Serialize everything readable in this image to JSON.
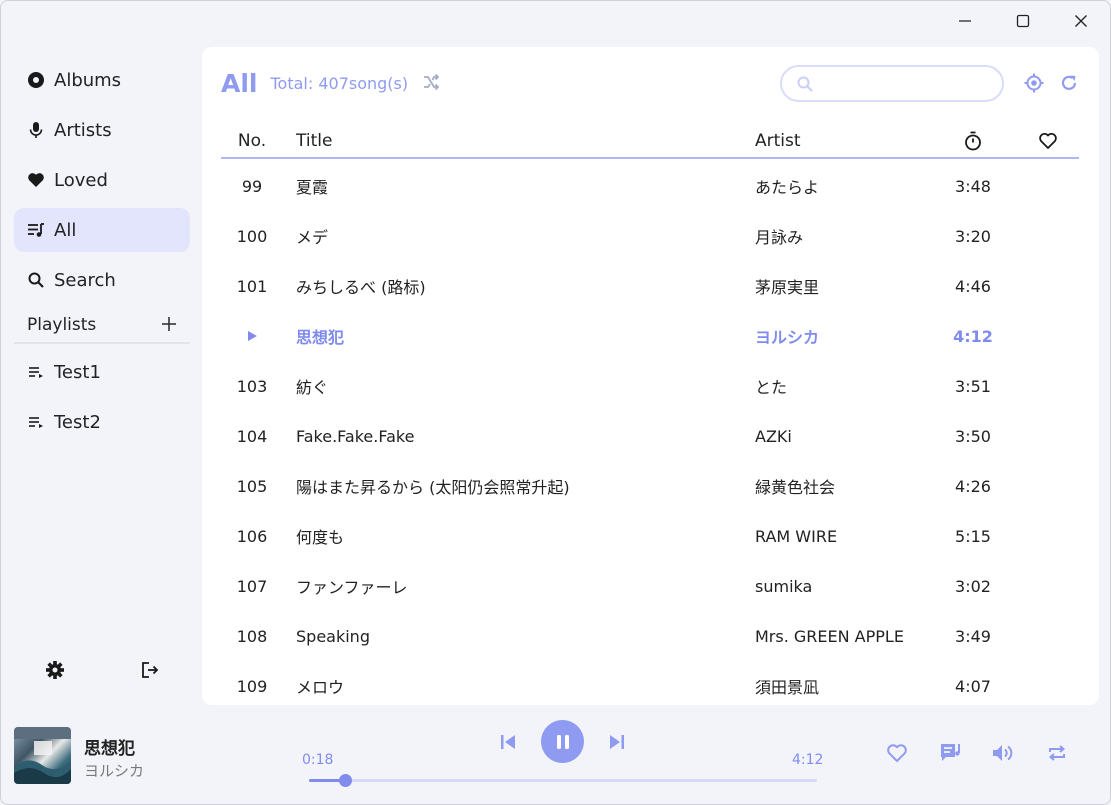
{
  "sidebar": {
    "nav": [
      {
        "label": "Albums",
        "icon": "album-icon"
      },
      {
        "label": "Artists",
        "icon": "mic-icon"
      },
      {
        "label": "Loved",
        "icon": "heart-icon"
      },
      {
        "label": "All",
        "icon": "music-list-icon",
        "active": true
      },
      {
        "label": "Search",
        "icon": "search-icon"
      }
    ],
    "playlists_label": "Playlists",
    "playlists": [
      {
        "label": "Test1"
      },
      {
        "label": "Test2"
      }
    ]
  },
  "header": {
    "title": "All",
    "total": "Total: 407song(s)",
    "search_placeholder": ""
  },
  "table": {
    "columns": {
      "no": "No.",
      "title": "Title",
      "artist": "Artist"
    },
    "rows": [
      {
        "no": "99",
        "title": "夏霞",
        "artist": "あたらよ",
        "duration": "3:48"
      },
      {
        "no": "100",
        "title": "メデ",
        "artist": "月詠み",
        "duration": "3:20"
      },
      {
        "no": "101",
        "title": "みちしるべ (路标)",
        "artist": "茅原実里",
        "duration": "4:46"
      },
      {
        "no": "",
        "title": "思想犯",
        "artist": "ヨルシカ",
        "duration": "4:12",
        "playing": true
      },
      {
        "no": "103",
        "title": "紡ぐ",
        "artist": "とた",
        "duration": "3:51"
      },
      {
        "no": "104",
        "title": "Fake.Fake.Fake",
        "artist": "AZKi",
        "duration": "3:50"
      },
      {
        "no": "105",
        "title": "陽はまた昇るから (太阳仍会照常升起)",
        "artist": "緑黄色社会",
        "duration": "4:26"
      },
      {
        "no": "106",
        "title": "何度も",
        "artist": "RAM WIRE",
        "duration": "5:15"
      },
      {
        "no": "107",
        "title": "ファンファーレ",
        "artist": "sumika",
        "duration": "3:02"
      },
      {
        "no": "108",
        "title": "Speaking",
        "artist": "Mrs. GREEN APPLE",
        "duration": "3:49"
      },
      {
        "no": "109",
        "title": "メロウ",
        "artist": "須田景凪",
        "duration": "4:07"
      }
    ]
  },
  "player": {
    "title": "思想犯",
    "artist": "ヨルシカ",
    "current_time": "0:18",
    "total_time": "4:12",
    "progress_fraction": 0.071
  },
  "colors": {
    "accent": "#8f9bf0",
    "accent_strong": "#7f8cee",
    "sidebar_active": "#e2e5fb",
    "background": "#f3f4fa"
  }
}
